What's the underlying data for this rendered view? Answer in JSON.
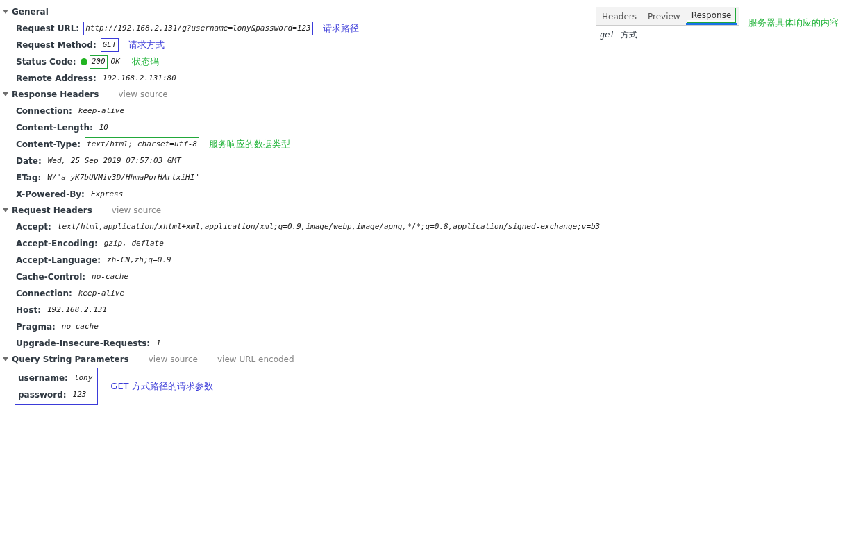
{
  "sections": [
    {
      "title": "General",
      "expanded": true,
      "items": [
        {
          "name": "Request URL:",
          "value": "http://192.168.2.131/g?username=lony&password=123",
          "outline": {
            "color": "#3b3bd9"
          },
          "note": {
            "text": "请求路径",
            "color": "#3b3bd9"
          }
        },
        {
          "name": "Request Method:",
          "value": "GET",
          "outline": {
            "color": "#3b3bd9"
          },
          "note": {
            "text": "请求方式",
            "color": "#3b3bd9"
          }
        },
        {
          "name": "Status Code:",
          "status_dot": {
            "color": "#22b422"
          },
          "value": "200",
          "outline": {
            "color": "#22a83a"
          },
          "suffix": "OK",
          "note": {
            "text": "状态码",
            "color": "#22b43a"
          }
        },
        {
          "name": "Remote Address:",
          "value": "192.168.2.131:80"
        }
      ]
    },
    {
      "title": "Response Headers",
      "expanded": true,
      "links": [
        "view source"
      ],
      "items": [
        {
          "name": "Connection:",
          "value": "keep-alive"
        },
        {
          "name": "Content-Length:",
          "value": "10"
        },
        {
          "name": "Content-Type:",
          "value": "text/html; charset=utf-8",
          "outline": {
            "color": "#22a83a"
          },
          "note": {
            "text": "服务响应的数据类型",
            "color": "#22b43a"
          }
        },
        {
          "name": "Date:",
          "value": "Wed, 25 Sep 2019 07:57:03 GMT"
        },
        {
          "name": "ETag:",
          "value": "W/\"a-yK7bUVMiv3D/HhmaPprHArtxiHI\""
        },
        {
          "name": "X-Powered-By:",
          "value": "Express"
        }
      ]
    },
    {
      "title": "Request Headers",
      "expanded": true,
      "links": [
        "view source"
      ],
      "items": [
        {
          "name": "Accept:",
          "value": "text/html,application/xhtml+xml,application/xml;q=0.9,image/webp,image/apng,*/*;q=0.8,application/signed-exchange;v=b3"
        },
        {
          "name": "Accept-Encoding:",
          "value": "gzip, deflate"
        },
        {
          "name": "Accept-Language:",
          "value": "zh-CN,zh;q=0.9"
        },
        {
          "name": "Cache-Control:",
          "value": "no-cache"
        },
        {
          "name": "Connection:",
          "value": "keep-alive"
        },
        {
          "name": "Host:",
          "value": "192.168.2.131"
        },
        {
          "name": "Pragma:",
          "value": "no-cache"
        },
        {
          "name": "Upgrade-Insecure-Requests:",
          "value": "1"
        }
      ]
    },
    {
      "title": "Query String Parameters",
      "expanded": true,
      "links": [
        "view source",
        "view URL encoded"
      ],
      "group_outline": {
        "color": "#3b3bd9"
      },
      "group_note": {
        "text": "GET 方式路径的请求参数",
        "color": "#3b3bd9"
      },
      "items": [
        {
          "name": "username:",
          "value": "lony"
        },
        {
          "name": "password:",
          "value": "123"
        }
      ]
    }
  ],
  "side_panel": {
    "tabs": [
      {
        "label": "Headers",
        "selected": false
      },
      {
        "label": "Preview",
        "selected": false
      },
      {
        "label": "Response",
        "selected": true,
        "outline": {
          "color": "#22a83a"
        }
      }
    ],
    "note": {
      "text": "服务器具体响应的内容",
      "color": "#22b43a"
    },
    "body": [
      {
        "text": "get",
        "mono": true
      },
      {
        "text": "方式",
        "mono": false
      }
    ]
  }
}
